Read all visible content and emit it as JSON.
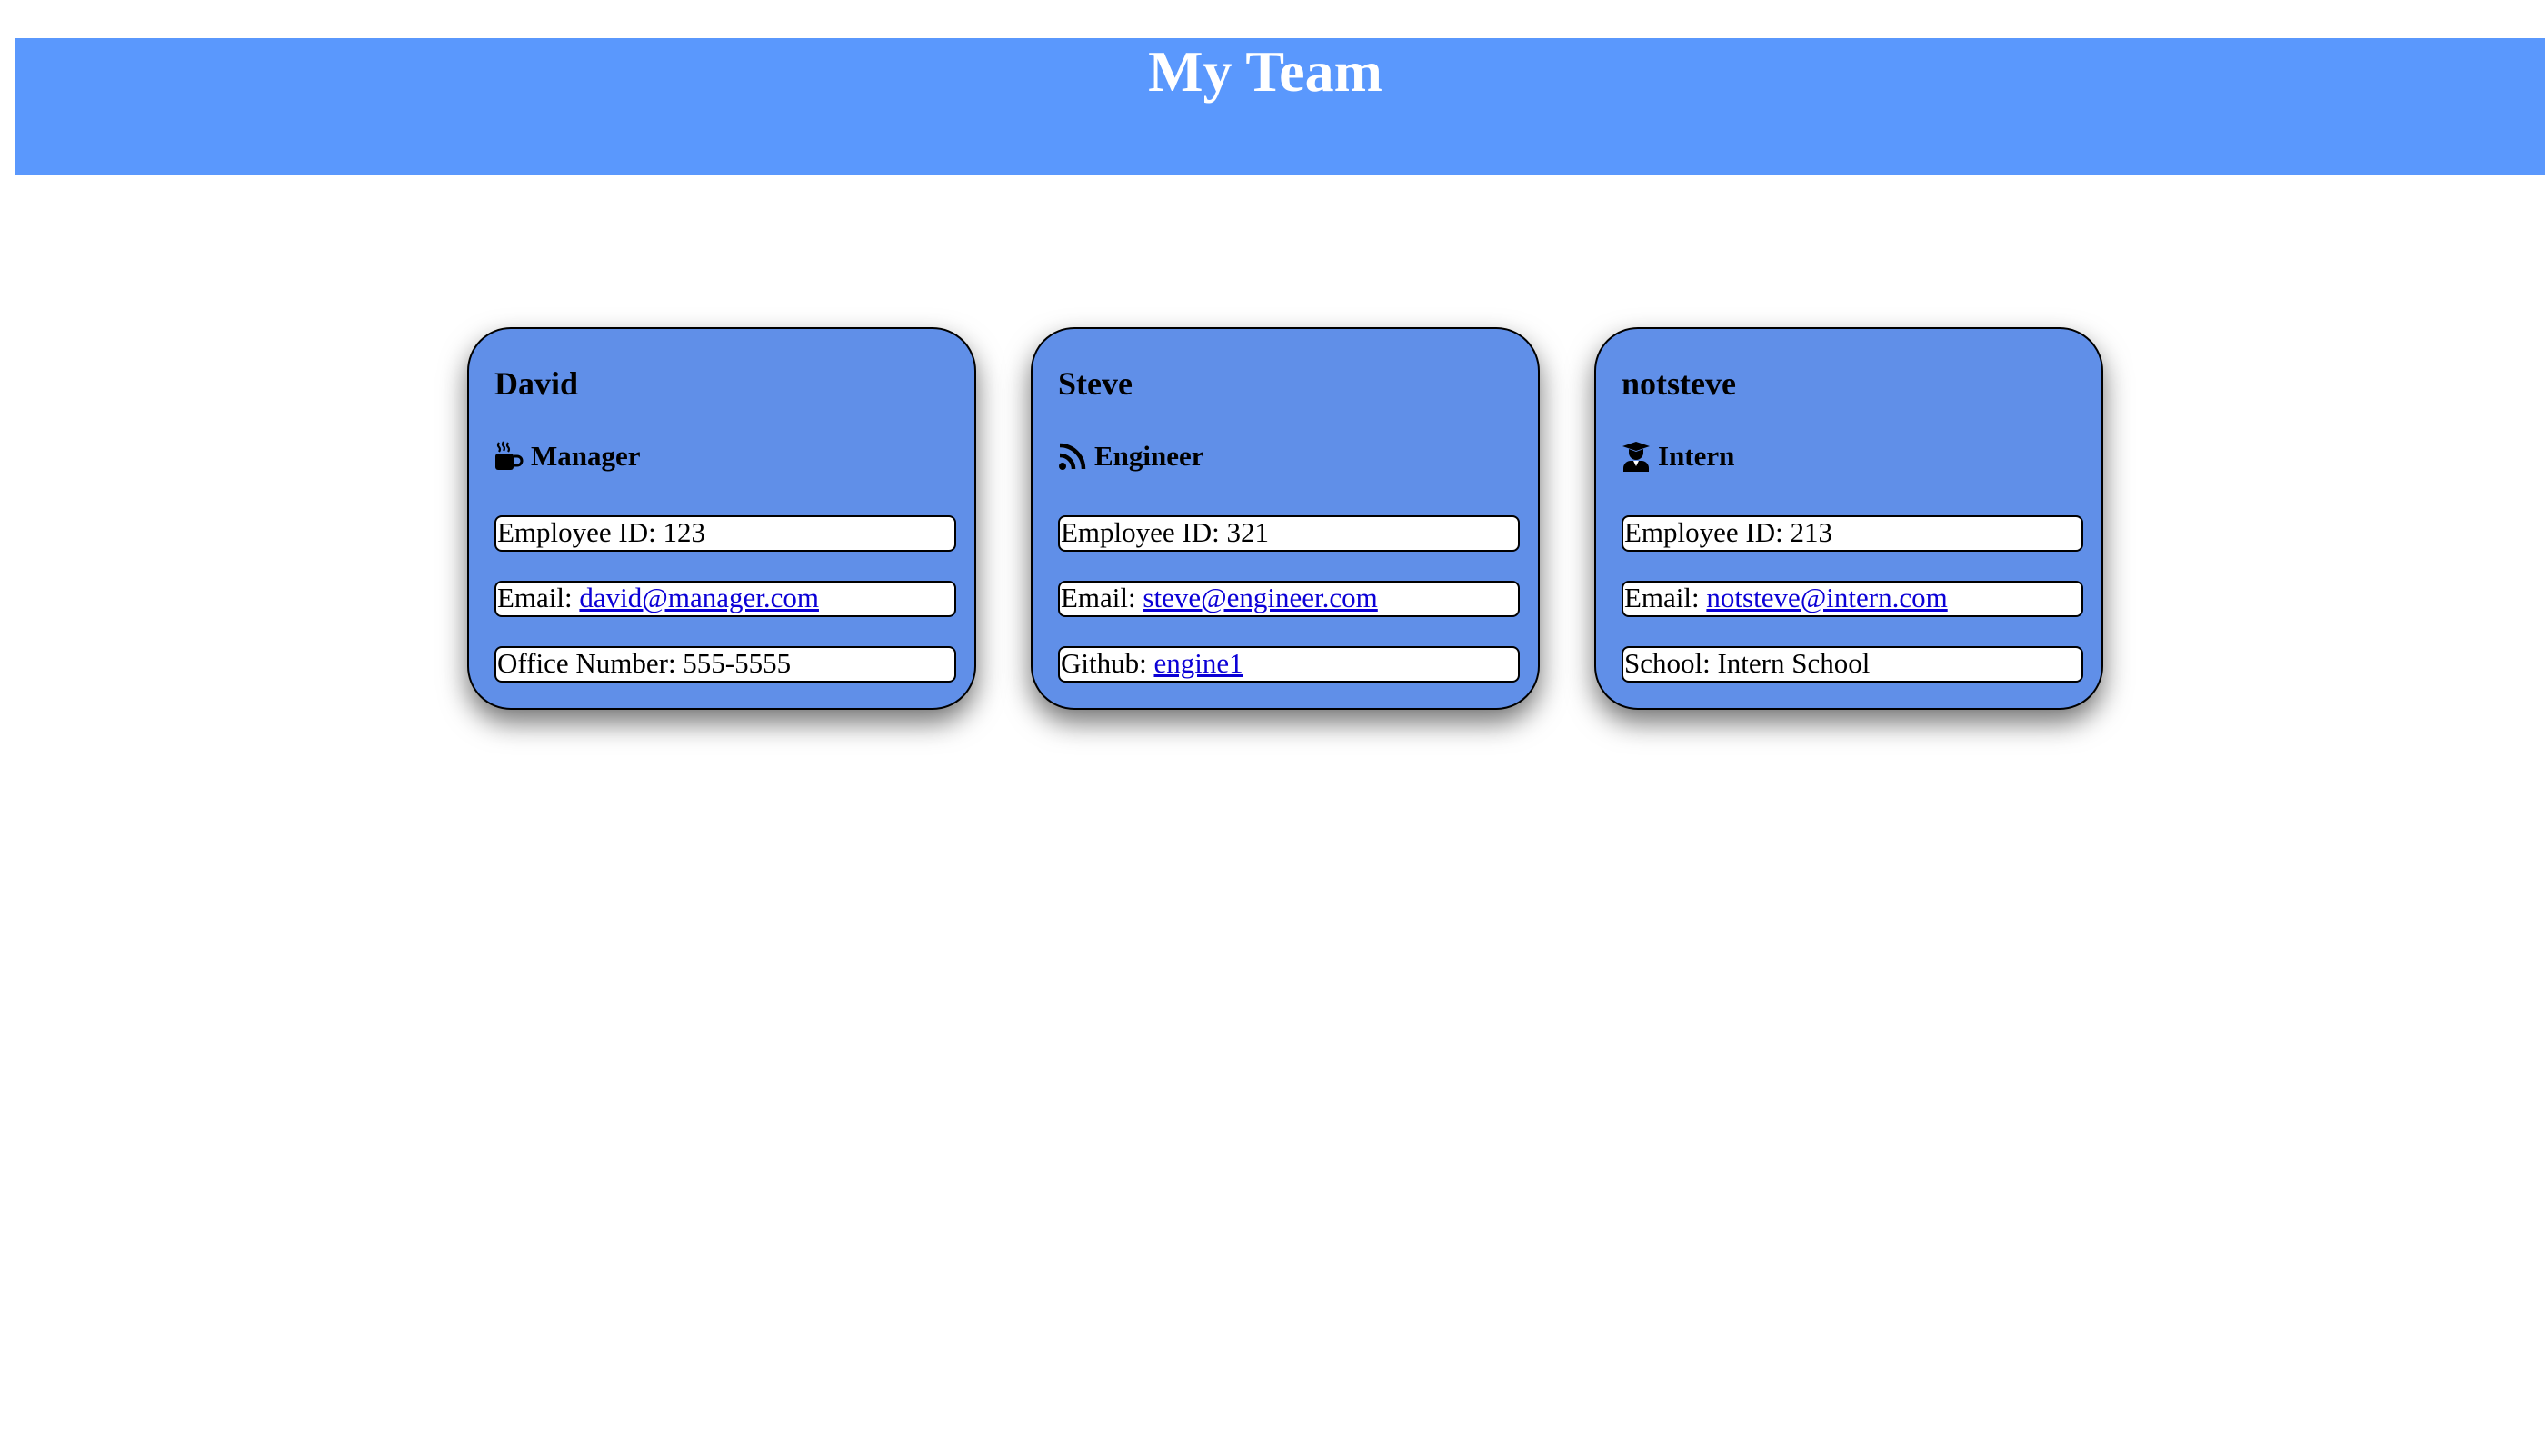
{
  "header": {
    "title": "My Team",
    "background": "#5a98fd"
  },
  "card_color": "#608fe8",
  "employees": [
    {
      "name": "David",
      "role": "Manager",
      "role_icon": "coffee-mug-icon",
      "id_label": "Employee ID: 123",
      "email_prefix": "Email: ",
      "email": "david@manager.com",
      "extra_label": "Office Number: 555-5555"
    },
    {
      "name": "Steve",
      "role": "Engineer",
      "role_icon": "rss-feed-icon",
      "id_label": "Employee ID: 321",
      "email_prefix": "Email: ",
      "email": "steve@engineer.com",
      "extra_prefix": "Github: ",
      "extra_link": "engine1"
    },
    {
      "name": "notsteve",
      "role": "Intern",
      "role_icon": "graduate-icon",
      "id_label": "Employee ID: 213",
      "email_prefix": "Email: ",
      "email": "notsteve@intern.com",
      "extra_label": "School: Intern School"
    }
  ]
}
